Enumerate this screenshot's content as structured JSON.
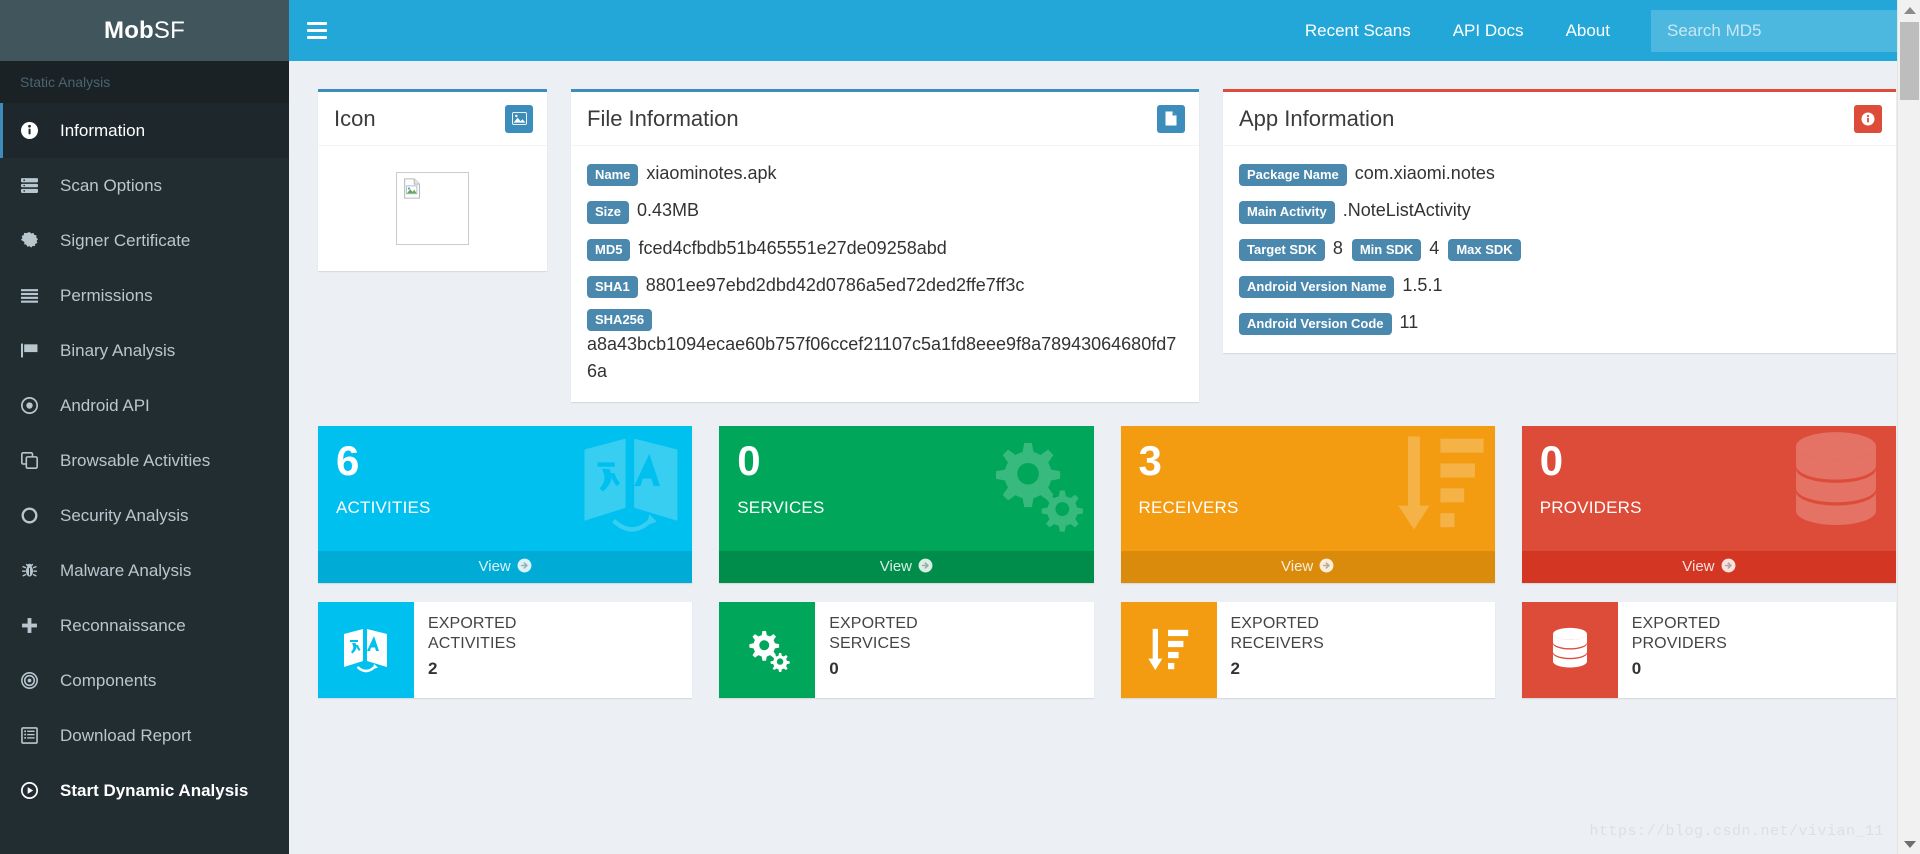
{
  "brand": {
    "bold": "Mob",
    "light": "SF"
  },
  "topbar": {
    "menu_toggle": "menu-toggle",
    "links": [
      {
        "label": "Recent Scans"
      },
      {
        "label": "API Docs"
      },
      {
        "label": "About"
      }
    ],
    "search": {
      "placeholder": "Search MD5",
      "value": ""
    }
  },
  "sidebar": {
    "header": "Static Analysis",
    "items": [
      {
        "label": "Information",
        "icon": "info-circle-icon",
        "active": true,
        "bold": false
      },
      {
        "label": "Scan Options",
        "icon": "server-icon",
        "active": false,
        "bold": false
      },
      {
        "label": "Signer Certificate",
        "icon": "certificate-icon",
        "active": false,
        "bold": false
      },
      {
        "label": "Permissions",
        "icon": "list-icon",
        "active": false,
        "bold": false
      },
      {
        "label": "Binary Analysis",
        "icon": "flag-icon",
        "active": false,
        "bold": false
      },
      {
        "label": "Android API",
        "icon": "dot-circle-icon",
        "active": false,
        "bold": false
      },
      {
        "label": "Browsable Activities",
        "icon": "clone-icon",
        "active": false,
        "bold": false
      },
      {
        "label": "Security Analysis",
        "icon": "circle-outline-icon",
        "active": false,
        "bold": false
      },
      {
        "label": "Malware Analysis",
        "icon": "bug-icon",
        "active": false,
        "bold": false
      },
      {
        "label": "Reconnaissance",
        "icon": "plus-icon",
        "active": false,
        "bold": false
      },
      {
        "label": "Components",
        "icon": "bullseye-icon",
        "active": false,
        "bold": false
      },
      {
        "label": "Download Report",
        "icon": "report-icon",
        "active": false,
        "bold": false
      },
      {
        "label": "Start Dynamic Analysis",
        "icon": "play-circle-icon",
        "active": false,
        "bold": true
      }
    ]
  },
  "cards": {
    "icon_card": {
      "title": "Icon",
      "badge_icon": "image-icon",
      "image_alt": "broken-image"
    },
    "file_info": {
      "title": "File Information",
      "badge_icon": "file-icon",
      "rows": [
        {
          "tag": "Name",
          "value": "xiaominotes.apk"
        },
        {
          "tag": "Size",
          "value": "0.43MB"
        },
        {
          "tag": "MD5",
          "value": "fced4cfbdb51b465551e27de09258abd"
        },
        {
          "tag": "SHA1",
          "value": "8801ee97ebd2dbd42d0786a5ed72ded2ffe7ff3c"
        },
        {
          "tag": "SHA256",
          "value": "a8a43bcb1094ecae60b757f06ccef21107c5a1fd8eee9f8a78943064680fd76a"
        }
      ]
    },
    "app_info": {
      "title": "App Information",
      "badge_icon": "info-icon",
      "rows": [
        {
          "tag": "Package Name",
          "value": "com.xiaomi.notes"
        },
        {
          "tag": "Main Activity",
          "value": ".NoteListActivity"
        },
        {
          "tag": "Android Version Name",
          "value": "1.5.1"
        },
        {
          "tag": "Android Version Code",
          "value": "11"
        }
      ],
      "sdk": {
        "target_tag": "Target SDK",
        "target_value": "8",
        "min_tag": "Min SDK",
        "min_value": "4",
        "max_tag": "Max SDK",
        "max_value": ""
      }
    }
  },
  "stat_tiles": [
    {
      "number": "6",
      "label": "ACTIVITIES",
      "view": "View",
      "color": "#00c0ef",
      "art": "activities-art-icon"
    },
    {
      "number": "0",
      "label": "SERVICES",
      "view": "View",
      "color": "#00a65a",
      "art": "gears-art-icon"
    },
    {
      "number": "3",
      "label": "RECEIVERS",
      "view": "View",
      "color": "#f39c12",
      "art": "sort-amount-art-icon"
    },
    {
      "number": "0",
      "label": "PROVIDERS",
      "view": "View",
      "color": "#dd4b39",
      "art": "database-art-icon"
    }
  ],
  "exported_tiles": [
    {
      "line1": "EXPORTED",
      "line2": "ACTIVITIES",
      "number": "2",
      "color": "#00c0ef",
      "icon": "activities-icon"
    },
    {
      "line1": "EXPORTED",
      "line2": "SERVICES",
      "number": "0",
      "color": "#00a65a",
      "icon": "gears-icon"
    },
    {
      "line1": "EXPORTED",
      "line2": "RECEIVERS",
      "number": "2",
      "color": "#f39c12",
      "icon": "sort-amount-icon"
    },
    {
      "line1": "EXPORTED",
      "line2": "PROVIDERS",
      "number": "0",
      "color": "#dd4b39",
      "icon": "database-icon"
    }
  ],
  "watermark": "https://blog.csdn.net/vivian_11"
}
